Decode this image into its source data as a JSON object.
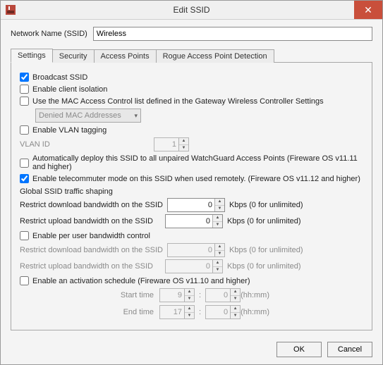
{
  "window": {
    "title": "Edit SSID"
  },
  "network_name": {
    "label": "Network Name (SSID)",
    "value": "Wireless"
  },
  "tabs": [
    {
      "label": "Settings",
      "selected": true
    },
    {
      "label": "Security",
      "selected": false
    },
    {
      "label": "Access Points",
      "selected": false
    },
    {
      "label": "Rogue Access Point Detection",
      "selected": false
    }
  ],
  "settings": {
    "broadcast_ssid": {
      "label": "Broadcast SSID",
      "checked": true
    },
    "client_isolation": {
      "label": "Enable client isolation",
      "checked": false
    },
    "mac_acl": {
      "label": "Use the MAC Access Control list defined in the Gateway Wireless Controller Settings",
      "checked": false,
      "combo_value": "Denied MAC Addresses"
    },
    "vlan": {
      "label": "Enable VLAN tagging",
      "checked": false,
      "id_label": "VLAN ID",
      "id_value": "1"
    },
    "auto_deploy": {
      "label": "Automatically deploy this SSID to all unpaired WatchGuard Access Points (Fireware OS v11.11 and higher)",
      "checked": false
    },
    "telecommuter": {
      "label": "Enable telecommuter mode on this SSID when used remotely.  (Fireware OS v11.12 and higher)",
      "checked": true
    },
    "global_shaping": {
      "title": "Global SSID traffic shaping",
      "dl_label": "Restrict download bandwidth on the SSID",
      "dl_value": "0",
      "ul_label": "Restrict upload bandwidth on the SSID",
      "ul_value": "0",
      "unit": "Kbps (0 for unlimited)"
    },
    "per_user": {
      "label": "Enable per user bandwidth control",
      "checked": false,
      "dl_label": "Restrict download bandwidth on the SSID",
      "dl_value": "0",
      "ul_label": "Restrict upload bandwidth on the SSID",
      "ul_value": "0",
      "unit": "Kbps (0 for unlimited)"
    },
    "schedule": {
      "label": "Enable an activation schedule (Fireware OS v11.10 and higher)",
      "checked": false,
      "start_label": "Start time",
      "start_h": "9",
      "start_m": "0",
      "end_label": "End time",
      "end_h": "17",
      "end_m": "0",
      "hhmm": "(hh:mm)"
    }
  },
  "buttons": {
    "ok": "OK",
    "cancel": "Cancel"
  }
}
